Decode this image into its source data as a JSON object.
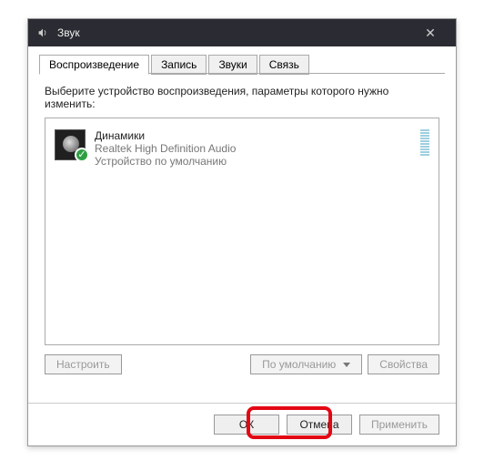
{
  "window": {
    "title": "Звук"
  },
  "tabs": [
    {
      "label": "Воспроизведение"
    },
    {
      "label": "Запись"
    },
    {
      "label": "Звуки"
    },
    {
      "label": "Связь"
    }
  ],
  "instruction": "Выберите устройство воспроизведения, параметры которого нужно изменить:",
  "device": {
    "name": "Динамики",
    "subtitle": "Realtek High Definition Audio",
    "status": "Устройство по умолчанию"
  },
  "buttons": {
    "configure": "Настроить",
    "set_default": "По умолчанию",
    "properties": "Свойства",
    "ok": "ОК",
    "cancel": "Отмена",
    "apply": "Применить"
  }
}
